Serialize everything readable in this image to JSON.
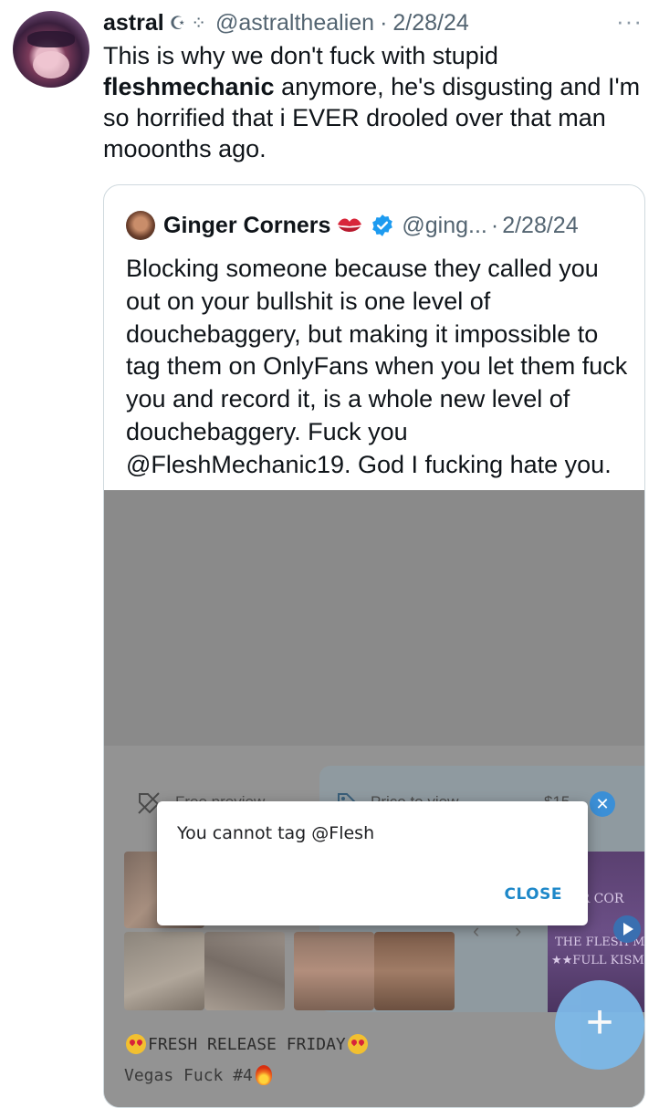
{
  "tweet": {
    "name": "astral",
    "name_decoration": "☪ ⁘",
    "handle": "@astralthealien",
    "separator": "·",
    "date": "2/28/24",
    "more_icon": "···",
    "text_before": "This is why we don't fuck with stupid ",
    "text_bold": "fleshmechanic",
    "text_after": " anymore, he's disgusting and I'm so horrified that i EVER drooled over that man mooonths ago."
  },
  "quote": {
    "name": "Ginger Corners",
    "handle": "@ging...",
    "separator": "·",
    "date": "2/28/24",
    "text": "Blocking someone because they called you out on your bullshit is one level of douchebaggery, but making it impossible to tag them on OnlyFans when you let them fuck you and record it, is a whole new level of douchebaggery. Fuck you @FleshMechanic19. God I fucking hate you."
  },
  "media": {
    "free_preview_label": "Free preview",
    "price_label": "Price to view",
    "price_value": "$15",
    "promo_line1": "NGER COR",
    "promo_line2": "THE FLESH M",
    "promo_line3": "★★FULL KISMET",
    "release_text": "FRESH RELEASE FRIDAY",
    "vegas_text": "Vegas Fuck #4"
  },
  "dialog": {
    "message": "You cannot tag @Flesh",
    "close_label": "CLOSE"
  },
  "fab": {
    "icon": "+"
  },
  "colors": {
    "accent": "#1d9bf0",
    "dialog_button": "#1e88c9",
    "fab": "#7cb8e8"
  }
}
